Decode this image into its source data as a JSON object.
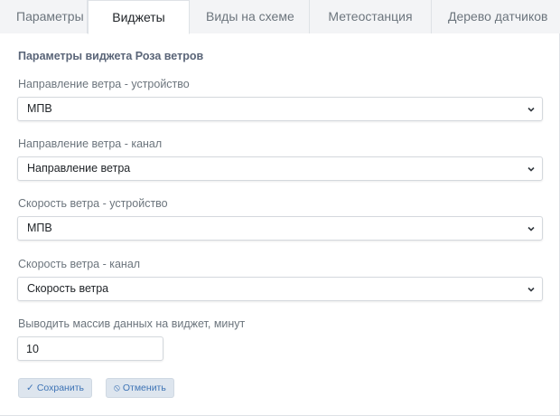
{
  "tabs": [
    {
      "label": "Параметры",
      "active": false
    },
    {
      "label": "Виджеты",
      "active": true
    },
    {
      "label": "Виды на схеме",
      "active": false
    },
    {
      "label": "Метеостанция",
      "active": false
    },
    {
      "label": "Дерево датчиков",
      "active": false
    }
  ],
  "form": {
    "title": "Параметры виджета Роза ветров",
    "wind_dir_device": {
      "label": "Направление ветра - устройство",
      "value": "МПВ"
    },
    "wind_dir_channel": {
      "label": "Направление ветра - канал",
      "value": "Направление ветра"
    },
    "wind_speed_device": {
      "label": "Скорость ветра - устройство",
      "value": "МПВ"
    },
    "wind_speed_channel": {
      "label": "Скорость ветра - канал",
      "value": "Скорость ветра"
    },
    "data_minutes": {
      "label": "Выводить массив данных на виджет, минут",
      "value": "10"
    }
  },
  "buttons": {
    "save": {
      "icon": "check-icon",
      "label": "Сохранить"
    },
    "cancel": {
      "icon": "ban-icon",
      "label": "Отменить"
    }
  },
  "colors": {
    "accent": "#3d73b5",
    "button_bg": "#dde5ee",
    "title": "#5a6578"
  }
}
